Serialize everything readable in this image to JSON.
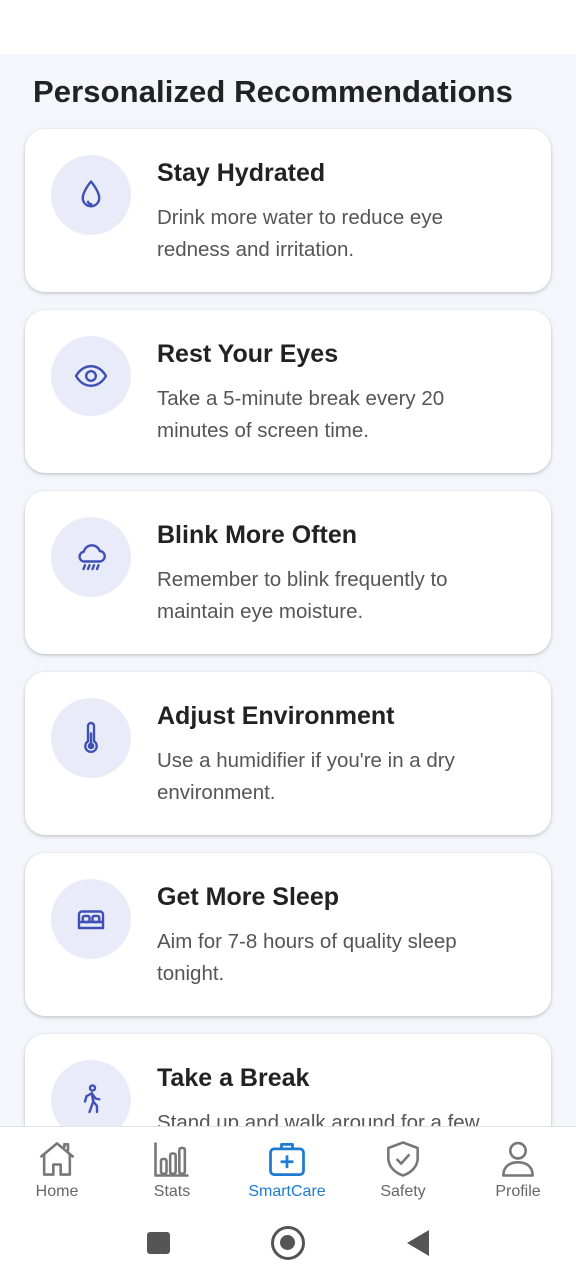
{
  "page": {
    "title": "Personalized Recommendations"
  },
  "colors": {
    "accent": "#1f7bd1",
    "icon": "#3f51b5",
    "icon_bg": "#e9ecf8",
    "background": "#f4f6fb"
  },
  "recommendations": [
    {
      "icon": "water-drop-icon",
      "title": "Stay Hydrated",
      "description": "Drink more water to reduce eye redness and irritation."
    },
    {
      "icon": "eye-icon",
      "title": "Rest Your Eyes",
      "description": "Take a 5-minute break every 20 minutes of screen time."
    },
    {
      "icon": "rain-cloud-icon",
      "title": "Blink More Often",
      "description": "Remember to blink frequently to maintain eye moisture."
    },
    {
      "icon": "thermometer-icon",
      "title": "Adjust Environment",
      "description": "Use a humidifier if you're in a dry environment."
    },
    {
      "icon": "bed-icon",
      "title": "Get More Sleep",
      "description": "Aim for 7-8 hours of quality sleep tonight."
    },
    {
      "icon": "walking-icon",
      "title": "Take a Break",
      "description": "Stand up and walk around for a few"
    }
  ],
  "nav": {
    "items": [
      {
        "label": "Home",
        "icon": "home-icon"
      },
      {
        "label": "Stats",
        "icon": "bar-chart-icon"
      },
      {
        "label": "SmartCare",
        "icon": "medical-kit-icon",
        "active": true
      },
      {
        "label": "Safety",
        "icon": "shield-check-icon"
      },
      {
        "label": "Profile",
        "icon": "person-icon"
      }
    ]
  },
  "system_nav": {
    "buttons": [
      "recents-button",
      "home-button",
      "back-button"
    ]
  }
}
